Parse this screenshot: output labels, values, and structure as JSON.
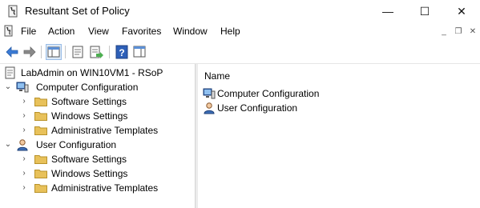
{
  "window": {
    "title": "Resultant Set of Policy",
    "minimize_glyph": "—",
    "maximize_glyph": "☐",
    "close_glyph": "✕"
  },
  "menu": {
    "items": [
      "File",
      "Action",
      "View",
      "Favorites",
      "Window",
      "Help"
    ]
  },
  "mdi": {
    "minimize": "_",
    "restore": "❐",
    "close": "✕"
  },
  "toolbar": {
    "buttons": [
      "back-icon",
      "forward-icon",
      "show-hide-console-tree-icon",
      "properties-icon",
      "export-list-icon",
      "help-icon",
      "show-action-pane-icon"
    ]
  },
  "tree": {
    "root": "LabAdmin on WIN10VM1 - RSoP",
    "computer": {
      "label": "Computer Configuration",
      "children": [
        "Software Settings",
        "Windows Settings",
        "Administrative Templates"
      ]
    },
    "user": {
      "label": "User Configuration",
      "children": [
        "Software Settings",
        "Windows Settings",
        "Administrative Templates"
      ]
    }
  },
  "list": {
    "column_header": "Name",
    "items": [
      "Computer Configuration",
      "User Configuration"
    ]
  },
  "colors": {
    "folder": "#e8c15a",
    "accent": "#2b6cb0",
    "selection": "#dce9f7"
  }
}
